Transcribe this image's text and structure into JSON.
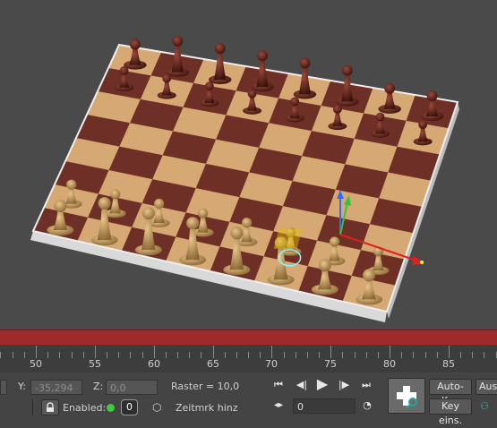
{
  "timeline": {
    "labels": [
      "50",
      "55",
      "60",
      "65",
      "70",
      "75",
      "80",
      "85"
    ]
  },
  "status": {
    "y_label": "Y:",
    "y_value": "-35,294",
    "z_label": "Z:",
    "z_value": "0,0",
    "grid_label": "Raster = 10,0",
    "enabled_label": "Enabled:",
    "enabled_count": "0",
    "time_tag_label": "Zeitmrk hinz",
    "frame_value": "0"
  },
  "buttons": {
    "auto_key": "Auto-Key",
    "key_set": "Key eins.",
    "cut_off": "Aus"
  },
  "colors": {
    "viewport_bg": "#4a4a4a",
    "trackbar": "#9e2a2a",
    "enabled_dot": "#3ccc3c"
  },
  "icons": [
    "lock-icon",
    "cube-icon",
    "go-to-start-icon",
    "prev-frame-icon",
    "play-icon",
    "next-frame-icon",
    "go-to-end-icon",
    "key-mode-icon",
    "time-config-icon",
    "set-key-icon",
    "key-filter-icon"
  ]
}
